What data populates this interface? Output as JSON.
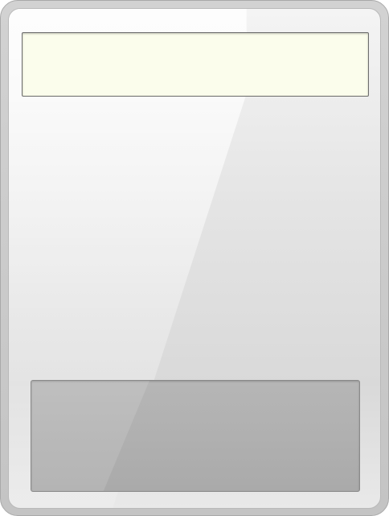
{
  "display": {
    "value": ""
  },
  "colors": {
    "device_body": "#d2d2d2",
    "display_background": "#fbfdec",
    "keypad_background": "#aaaaaa"
  }
}
